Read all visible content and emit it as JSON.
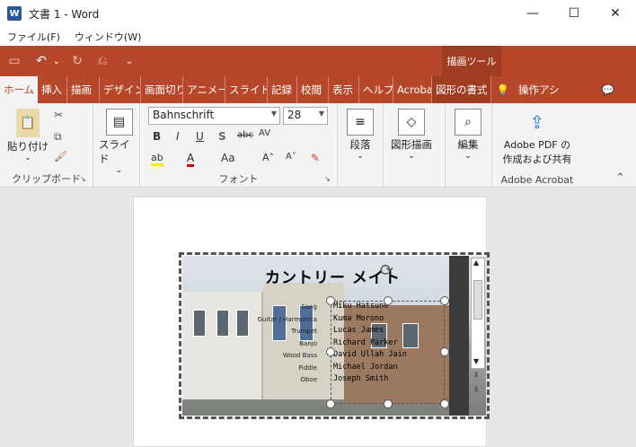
{
  "window": {
    "title": "文書 1 - Word",
    "minimize": "—",
    "maximize": "☐",
    "close": "✕"
  },
  "menubar": {
    "file": "ファイル(F)",
    "window": "ウィンドウ(W)"
  },
  "qat": {
    "save": "▭",
    "undo": "↶",
    "undo_dd": "⌄",
    "redo": "↻",
    "repeat": "⎌",
    "custom": "⌄"
  },
  "context_tab_header": "描画ツール",
  "tabs": [
    "ホーム",
    "挿入",
    "描画",
    "デザイン",
    "画面切り",
    "アニメー",
    "スライド",
    "記録",
    "校閲",
    "表示",
    "ヘルプ",
    "Acroba",
    "図形の書式",
    "💡",
    "操作アシ",
    "💬"
  ],
  "ribbon": {
    "clipboard": {
      "paste": "貼り付け",
      "label": "クリップボード"
    },
    "slide": {
      "label": "スライド",
      "dd": "⌄"
    },
    "font": {
      "name": "Bahnschrift",
      "size": "28",
      "label": "フォント",
      "bold": "B",
      "italic": "I",
      "underline": "U",
      "shadow": "S",
      "strike": "abc",
      "spacing": "AV",
      "highlight": "ab",
      "color": "A",
      "case": "Aa",
      "grow": "A˄",
      "shrink": "A˅",
      "clear": "✎"
    },
    "paragraph": {
      "label": "段落"
    },
    "drawing": {
      "label": "図形描画"
    },
    "editing": {
      "label": "編集"
    },
    "acrobat": {
      "line1": "Adobe PDF の",
      "line2": "作成および共有",
      "label": "Adobe Acrobat"
    },
    "collapse": "⌃"
  },
  "picture": {
    "title": "カントリー メイト",
    "credits": [
      {
        "role": "Song",
        "name": "Miku Hatsune"
      },
      {
        "role": "Guitar / Harmonica",
        "name": "Kuma Morono"
      },
      {
        "role": "Trumpet",
        "name": "Lucas James"
      },
      {
        "role": "Banjo",
        "name": "Richard Parker"
      },
      {
        "role": "Wood Bass",
        "name": "David Ullah Jain"
      },
      {
        "role": "Fiddle",
        "name": "Michael Jordan"
      },
      {
        "role": "Oboe",
        "name": "Joseph Smith"
      }
    ]
  },
  "colors": {
    "accent": "#b7472a",
    "context": "#a03c22"
  }
}
